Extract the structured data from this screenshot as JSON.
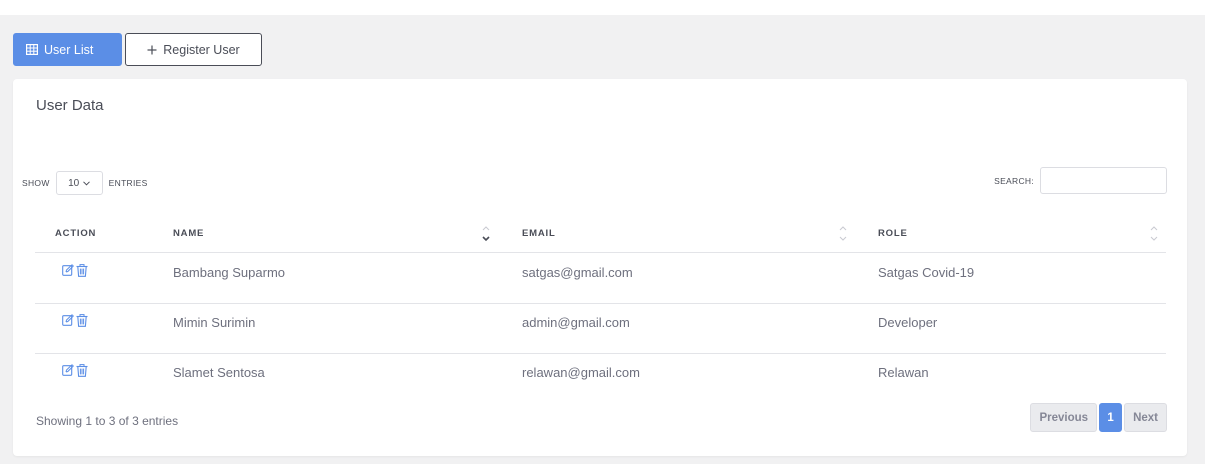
{
  "tabs": [
    {
      "label": "User List",
      "icon": "table-icon",
      "active": true
    },
    {
      "label": "Register User",
      "icon": "plus-icon",
      "active": false
    }
  ],
  "card": {
    "title": "User Data"
  },
  "length": {
    "show_label": "SHOW",
    "value": "10",
    "entries_label": "ENTRIES"
  },
  "search": {
    "label": "SEARCH:",
    "value": ""
  },
  "table": {
    "headers": [
      "ACTION",
      "NAME",
      "EMAIL",
      "ROLE"
    ],
    "rows": [
      {
        "name": "Bambang Suparmo",
        "email": "satgas@gmail.com",
        "role": "Satgas Covid-19"
      },
      {
        "name": "Mimin Surimin",
        "email": "admin@gmail.com",
        "role": "Developer"
      },
      {
        "name": "Slamet Sentosa",
        "email": "relawan@gmail.com",
        "role": "Relawan"
      }
    ],
    "sorted_column": "NAME",
    "sort_direction": "descending"
  },
  "info": "Showing 1 to 3 of 3 entries",
  "pagination": {
    "previous": "Previous",
    "current": "1",
    "next": "Next"
  },
  "colors": {
    "accent": "#5b8ee6",
    "page_bg": "#f1f1f2",
    "text": "#6e707e"
  }
}
